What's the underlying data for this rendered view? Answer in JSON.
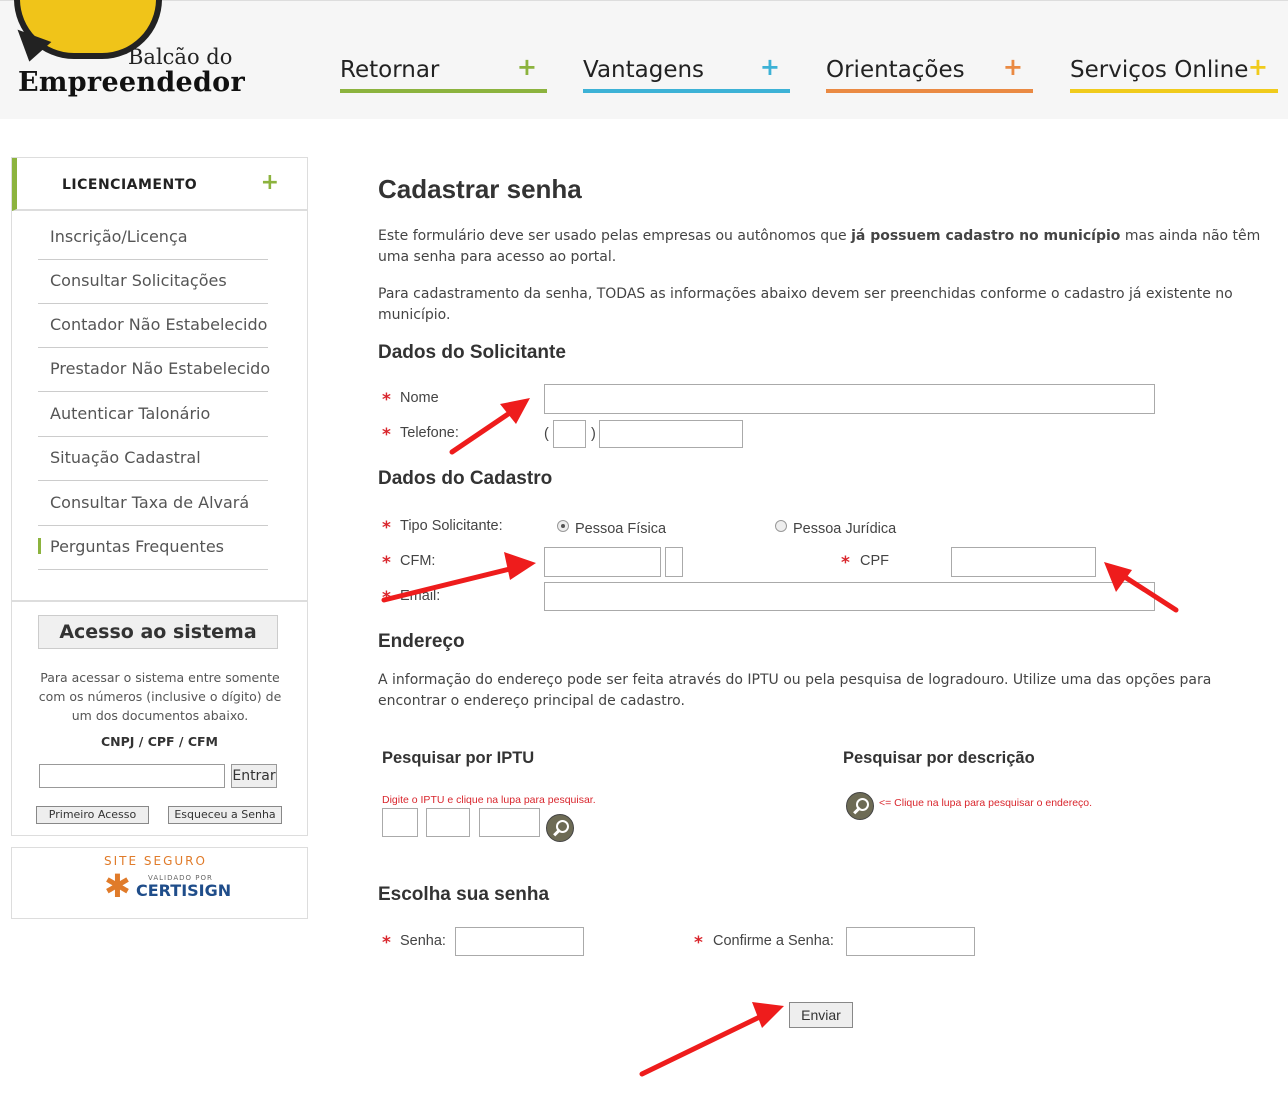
{
  "header": {
    "logo_line1": "Balcão do",
    "logo_line2": "Empreendedor",
    "nav": [
      {
        "label": "Retornar",
        "plus": "+",
        "color": "#8cb33e"
      },
      {
        "label": "Vantagens",
        "plus": "+",
        "color": "#3db2d6"
      },
      {
        "label": "Orientações",
        "plus": "+",
        "color": "#ea8a43"
      },
      {
        "label": "Serviços Online",
        "plus": "+",
        "color": "#f0cb1c"
      }
    ]
  },
  "sidebar": {
    "section_title": "LICENCIAMENTO",
    "section_plus": "+",
    "items": [
      {
        "label": "Inscrição/Licença"
      },
      {
        "label": "Consultar Solicitações"
      },
      {
        "label": "Contador Não Estabelecido"
      },
      {
        "label": "Prestador Não Estabelecido"
      },
      {
        "label": "Autenticar Talonário"
      },
      {
        "label": "Situação Cadastral"
      },
      {
        "label": "Consultar Taxa de Alvará"
      },
      {
        "label": "Perguntas Frequentes"
      }
    ],
    "access": {
      "title": "Acesso ao sistema",
      "text": "Para acessar o sistema entre somente com os números (inclusive o dígito) de um dos documentos abaixo.",
      "docs": "CNPJ / CPF / CFM",
      "enter_label": "Entrar",
      "first_access_label": "Primeiro Acesso",
      "forgot_label": "Esqueceu a Senha"
    },
    "cert": {
      "line1": "SITE SEGURO",
      "line2": "VALIDADO POR",
      "line3": "CERTISIGN"
    }
  },
  "main": {
    "title": "Cadastrar senha",
    "intro1_pre": "Este formulário deve ser usado pelas empresas ou autônomos que ",
    "intro1_bold": "já possuem cadastro no município",
    "intro1_post": " mas ainda não têm uma senha para acesso ao portal.",
    "intro2": "Para cadastramento da senha, TODAS as informações abaixo devem ser preenchidas conforme o cadastro já existente no município.",
    "solicitante": {
      "title": "Dados do Solicitante",
      "nome_label": "Nome",
      "telefone_label": "Telefone:",
      "paren_open": "(",
      "paren_close": ")"
    },
    "cadastro": {
      "title": "Dados do Cadastro",
      "tipo_label": "Tipo Solicitante:",
      "pf_label": "Pessoa Física",
      "pj_label": "Pessoa Jurídica",
      "cfm_label": "CFM:",
      "cpf_label": "CPF",
      "email_label": "Email:"
    },
    "endereco": {
      "title": "Endereço",
      "text": "A informação do endereço pode ser feita através do IPTU ou pela pesquisa de logradouro. Utilize uma das opções para encontrar o endereço principal de cadastro.",
      "iptu_title": "Pesquisar por IPTU",
      "iptu_hint": "Digite o IPTU e clique na lupa para pesquisar.",
      "desc_title": "Pesquisar por descrição",
      "desc_hint": "<= Clique na lupa para pesquisar o endereço."
    },
    "senha": {
      "title": "Escolha sua senha",
      "senha_label": "Senha:",
      "confirme_label": "Confirme a Senha:"
    },
    "required_mark": "*",
    "submit_label": "Enviar"
  }
}
